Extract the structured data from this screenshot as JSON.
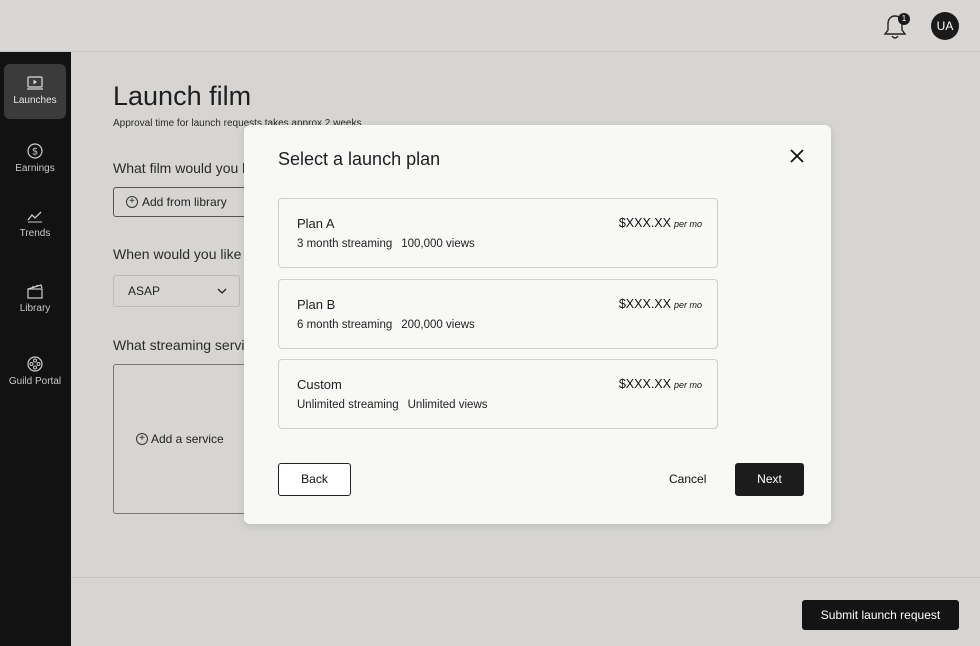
{
  "topbar": {
    "notification_count": "1",
    "avatar_initials": "UA",
    "icons": [
      "bell-icon"
    ]
  },
  "sidebar": {
    "items": [
      {
        "label": "Launches",
        "icon": "launches-icon",
        "active": true
      },
      {
        "label": "Earnings",
        "icon": "dollar-icon",
        "active": false
      },
      {
        "label": "Trends",
        "icon": "trend-icon",
        "active": false
      },
      {
        "label": "Library",
        "icon": "clapperboard-icon",
        "active": false
      },
      {
        "label": "Guild Portal",
        "icon": "film-reel-icon",
        "active": false
      }
    ]
  },
  "main": {
    "title": "Launch film",
    "subtitle": "Approval time for launch requests takes approx 2 weeks",
    "q_film": "What film would you l",
    "add_from_library": "Add from library",
    "q_when": "When would you like t",
    "when_value": "ASAP",
    "q_service": "What streaming servic",
    "add_service": "Add a service",
    "submit_label": "Submit launch request"
  },
  "modal": {
    "title": "Select a launch plan",
    "plans": [
      {
        "name": "Plan A",
        "streaming": "3 month streaming",
        "views": "100,000 views",
        "price": "$XXX.XX",
        "period": "per mo"
      },
      {
        "name": "Plan B",
        "streaming": "6 month streaming",
        "views": "200,000 views",
        "price": "$XXX.XX",
        "period": "per mo"
      },
      {
        "name": "Custom",
        "streaming": "Unlimited streaming",
        "views": "Unlimited views",
        "price": "$XXX.XX",
        "period": "per mo"
      }
    ],
    "back_label": "Back",
    "cancel_label": "Cancel",
    "next_label": "Next"
  },
  "colors": {
    "sidebar_bg": "#111211",
    "page_bg": "#d6d5d3",
    "modal_bg": "#f8f8f7",
    "primary_button": "#1c1c1c"
  }
}
